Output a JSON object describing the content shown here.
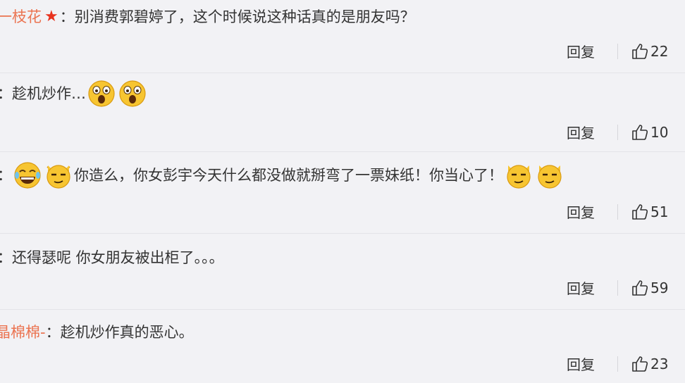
{
  "comments": [
    {
      "user": "一枝花",
      "colon": "：",
      "has_star": true,
      "text": "别消费郭碧婷了，这个时候说这种话真的是朋友吗？",
      "reply_label": "回复",
      "likes": "22"
    },
    {
      "user": "",
      "colon": "：",
      "text": "趁机炒作…",
      "emojis_after": [
        "shocked-face-icon",
        "shocked-face-icon"
      ],
      "reply_label": "回复",
      "likes": "10"
    },
    {
      "user": "",
      "colon": "：",
      "emojis_before": [
        "laughing-tears-face-icon",
        "smirk-cat-face-icon"
      ],
      "text": "你造么，你女彭宇今天什么都没做就掰弯了一票妹纸！你当心了！",
      "emojis_after": [
        "smirk-cat-face-icon",
        "smirk-cat-face-icon"
      ],
      "reply_label": "回复",
      "likes": "51"
    },
    {
      "user": "",
      "colon": "：",
      "text": "还得瑟呢 你女朋友被出柜了。。。",
      "reply_label": "回复",
      "likes": "59"
    },
    {
      "user": "晶棉棉-",
      "colon": "：",
      "text": "趁机炒作真的恶心。",
      "reply_label": "回复",
      "likes": "23"
    }
  ],
  "colors": {
    "background": "#f2f2f5",
    "username": "#eb7350",
    "text": "#333333",
    "divider": "#e4e4e8"
  },
  "icons": {
    "like": "thumbs-up-icon",
    "star": "red-star-icon"
  }
}
